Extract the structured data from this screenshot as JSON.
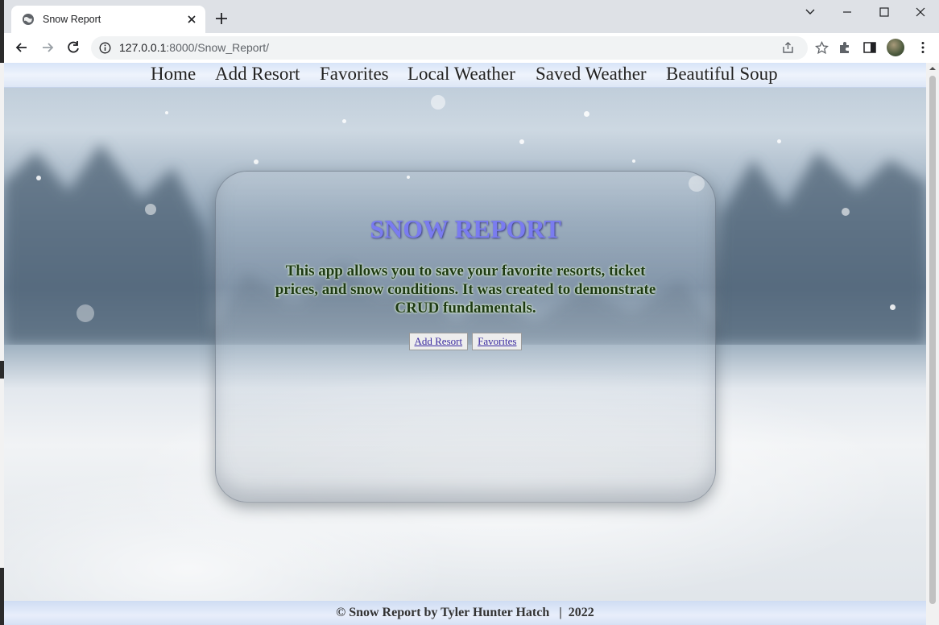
{
  "browser": {
    "tab_title": "Snow Report",
    "url_host": "127.0.0.1",
    "url_rest": ":8000/Snow_Report/"
  },
  "nav": {
    "items": [
      "Home",
      "Add Resort",
      "Favorites",
      "Local Weather",
      "Saved Weather",
      "Beautiful Soup"
    ]
  },
  "card": {
    "title": "SNOW REPORT",
    "text": "This app allows you to save your favorite resorts, ticket prices, and snow conditions. It was created to demonstrate CRUD fundamentals.",
    "buttons": [
      "Add Resort",
      "Favorites"
    ]
  },
  "footer": {
    "text": "© Snow Report by Tyler Hunter Hatch   |  2022"
  },
  "colors": {
    "title": "#7a7cf0",
    "body_text": "#1e3a14",
    "nav_bar": "#dde7f6"
  }
}
